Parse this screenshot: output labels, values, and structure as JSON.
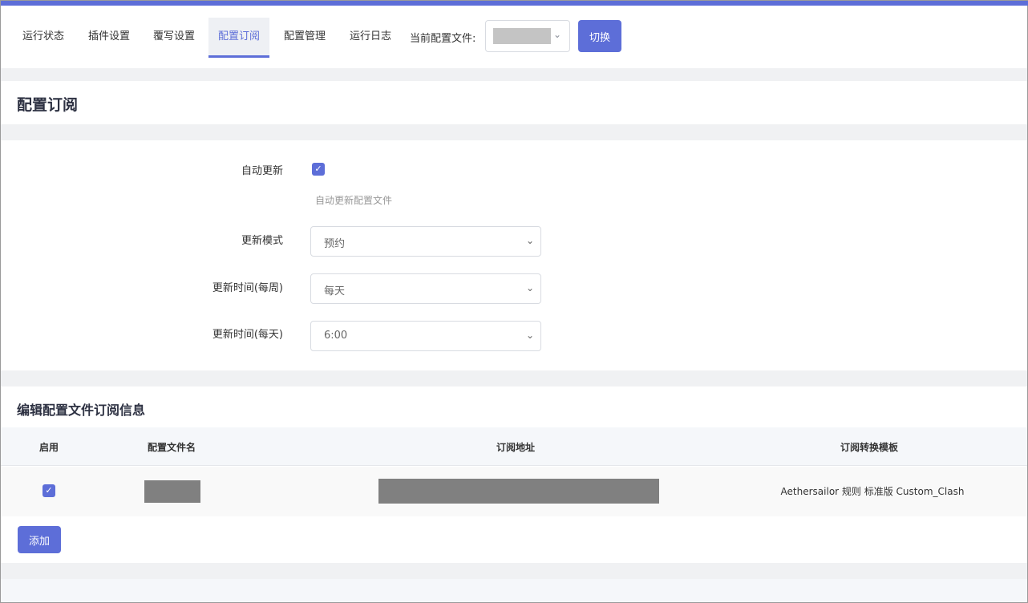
{
  "nav": {
    "tabs": [
      {
        "label": "运行状态"
      },
      {
        "label": "插件设置"
      },
      {
        "label": "覆写设置"
      },
      {
        "label": "配置订阅"
      },
      {
        "label": "配置管理"
      },
      {
        "label": "运行日志"
      }
    ],
    "active_tab": "配置订阅",
    "current_config_label": "当前配置文件:",
    "switch_label": "切换"
  },
  "page": {
    "title": "配置订阅"
  },
  "form": {
    "auto_update": {
      "label": "自动更新",
      "checked": true,
      "hint": "自动更新配置文件"
    },
    "update_mode": {
      "label": "更新模式",
      "value": "预约"
    },
    "update_weekly": {
      "label": "更新时间(每周)",
      "value": "每天"
    },
    "update_daily": {
      "label": "更新时间(每天)",
      "value": "6:00"
    }
  },
  "subscriptions": {
    "title": "编辑配置文件订阅信息",
    "columns": [
      "启用",
      "配置文件名",
      "订阅地址",
      "订阅转换模板"
    ],
    "rows": [
      {
        "enabled": true,
        "template": "Aethersailor 规则 标准版 Custom_Clash"
      }
    ],
    "add_label": "添加"
  },
  "colors": {
    "accent": "#5d6ed8"
  }
}
